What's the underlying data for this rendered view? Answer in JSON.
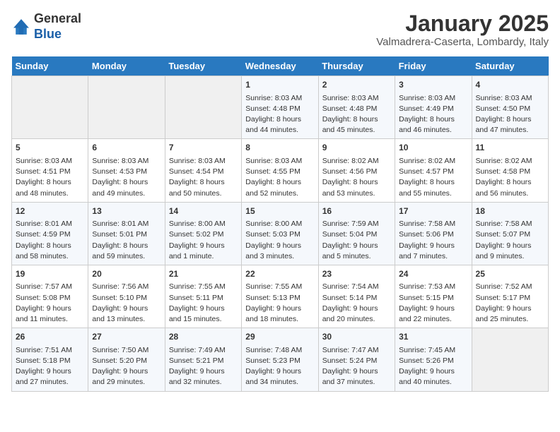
{
  "header": {
    "logo_general": "General",
    "logo_blue": "Blue",
    "month": "January 2025",
    "location": "Valmadrera-Caserta, Lombardy, Italy"
  },
  "days_of_week": [
    "Sunday",
    "Monday",
    "Tuesday",
    "Wednesday",
    "Thursday",
    "Friday",
    "Saturday"
  ],
  "weeks": [
    [
      {
        "day": "",
        "info": ""
      },
      {
        "day": "",
        "info": ""
      },
      {
        "day": "",
        "info": ""
      },
      {
        "day": "1",
        "info": "Sunrise: 8:03 AM\nSunset: 4:48 PM\nDaylight: 8 hours\nand 44 minutes."
      },
      {
        "day": "2",
        "info": "Sunrise: 8:03 AM\nSunset: 4:48 PM\nDaylight: 8 hours\nand 45 minutes."
      },
      {
        "day": "3",
        "info": "Sunrise: 8:03 AM\nSunset: 4:49 PM\nDaylight: 8 hours\nand 46 minutes."
      },
      {
        "day": "4",
        "info": "Sunrise: 8:03 AM\nSunset: 4:50 PM\nDaylight: 8 hours\nand 47 minutes."
      }
    ],
    [
      {
        "day": "5",
        "info": "Sunrise: 8:03 AM\nSunset: 4:51 PM\nDaylight: 8 hours\nand 48 minutes."
      },
      {
        "day": "6",
        "info": "Sunrise: 8:03 AM\nSunset: 4:53 PM\nDaylight: 8 hours\nand 49 minutes."
      },
      {
        "day": "7",
        "info": "Sunrise: 8:03 AM\nSunset: 4:54 PM\nDaylight: 8 hours\nand 50 minutes."
      },
      {
        "day": "8",
        "info": "Sunrise: 8:03 AM\nSunset: 4:55 PM\nDaylight: 8 hours\nand 52 minutes."
      },
      {
        "day": "9",
        "info": "Sunrise: 8:02 AM\nSunset: 4:56 PM\nDaylight: 8 hours\nand 53 minutes."
      },
      {
        "day": "10",
        "info": "Sunrise: 8:02 AM\nSunset: 4:57 PM\nDaylight: 8 hours\nand 55 minutes."
      },
      {
        "day": "11",
        "info": "Sunrise: 8:02 AM\nSunset: 4:58 PM\nDaylight: 8 hours\nand 56 minutes."
      }
    ],
    [
      {
        "day": "12",
        "info": "Sunrise: 8:01 AM\nSunset: 4:59 PM\nDaylight: 8 hours\nand 58 minutes."
      },
      {
        "day": "13",
        "info": "Sunrise: 8:01 AM\nSunset: 5:01 PM\nDaylight: 8 hours\nand 59 minutes."
      },
      {
        "day": "14",
        "info": "Sunrise: 8:00 AM\nSunset: 5:02 PM\nDaylight: 9 hours\nand 1 minute."
      },
      {
        "day": "15",
        "info": "Sunrise: 8:00 AM\nSunset: 5:03 PM\nDaylight: 9 hours\nand 3 minutes."
      },
      {
        "day": "16",
        "info": "Sunrise: 7:59 AM\nSunset: 5:04 PM\nDaylight: 9 hours\nand 5 minutes."
      },
      {
        "day": "17",
        "info": "Sunrise: 7:58 AM\nSunset: 5:06 PM\nDaylight: 9 hours\nand 7 minutes."
      },
      {
        "day": "18",
        "info": "Sunrise: 7:58 AM\nSunset: 5:07 PM\nDaylight: 9 hours\nand 9 minutes."
      }
    ],
    [
      {
        "day": "19",
        "info": "Sunrise: 7:57 AM\nSunset: 5:08 PM\nDaylight: 9 hours\nand 11 minutes."
      },
      {
        "day": "20",
        "info": "Sunrise: 7:56 AM\nSunset: 5:10 PM\nDaylight: 9 hours\nand 13 minutes."
      },
      {
        "day": "21",
        "info": "Sunrise: 7:55 AM\nSunset: 5:11 PM\nDaylight: 9 hours\nand 15 minutes."
      },
      {
        "day": "22",
        "info": "Sunrise: 7:55 AM\nSunset: 5:13 PM\nDaylight: 9 hours\nand 18 minutes."
      },
      {
        "day": "23",
        "info": "Sunrise: 7:54 AM\nSunset: 5:14 PM\nDaylight: 9 hours\nand 20 minutes."
      },
      {
        "day": "24",
        "info": "Sunrise: 7:53 AM\nSunset: 5:15 PM\nDaylight: 9 hours\nand 22 minutes."
      },
      {
        "day": "25",
        "info": "Sunrise: 7:52 AM\nSunset: 5:17 PM\nDaylight: 9 hours\nand 25 minutes."
      }
    ],
    [
      {
        "day": "26",
        "info": "Sunrise: 7:51 AM\nSunset: 5:18 PM\nDaylight: 9 hours\nand 27 minutes."
      },
      {
        "day": "27",
        "info": "Sunrise: 7:50 AM\nSunset: 5:20 PM\nDaylight: 9 hours\nand 29 minutes."
      },
      {
        "day": "28",
        "info": "Sunrise: 7:49 AM\nSunset: 5:21 PM\nDaylight: 9 hours\nand 32 minutes."
      },
      {
        "day": "29",
        "info": "Sunrise: 7:48 AM\nSunset: 5:23 PM\nDaylight: 9 hours\nand 34 minutes."
      },
      {
        "day": "30",
        "info": "Sunrise: 7:47 AM\nSunset: 5:24 PM\nDaylight: 9 hours\nand 37 minutes."
      },
      {
        "day": "31",
        "info": "Sunrise: 7:45 AM\nSunset: 5:26 PM\nDaylight: 9 hours\nand 40 minutes."
      },
      {
        "day": "",
        "info": ""
      }
    ]
  ]
}
